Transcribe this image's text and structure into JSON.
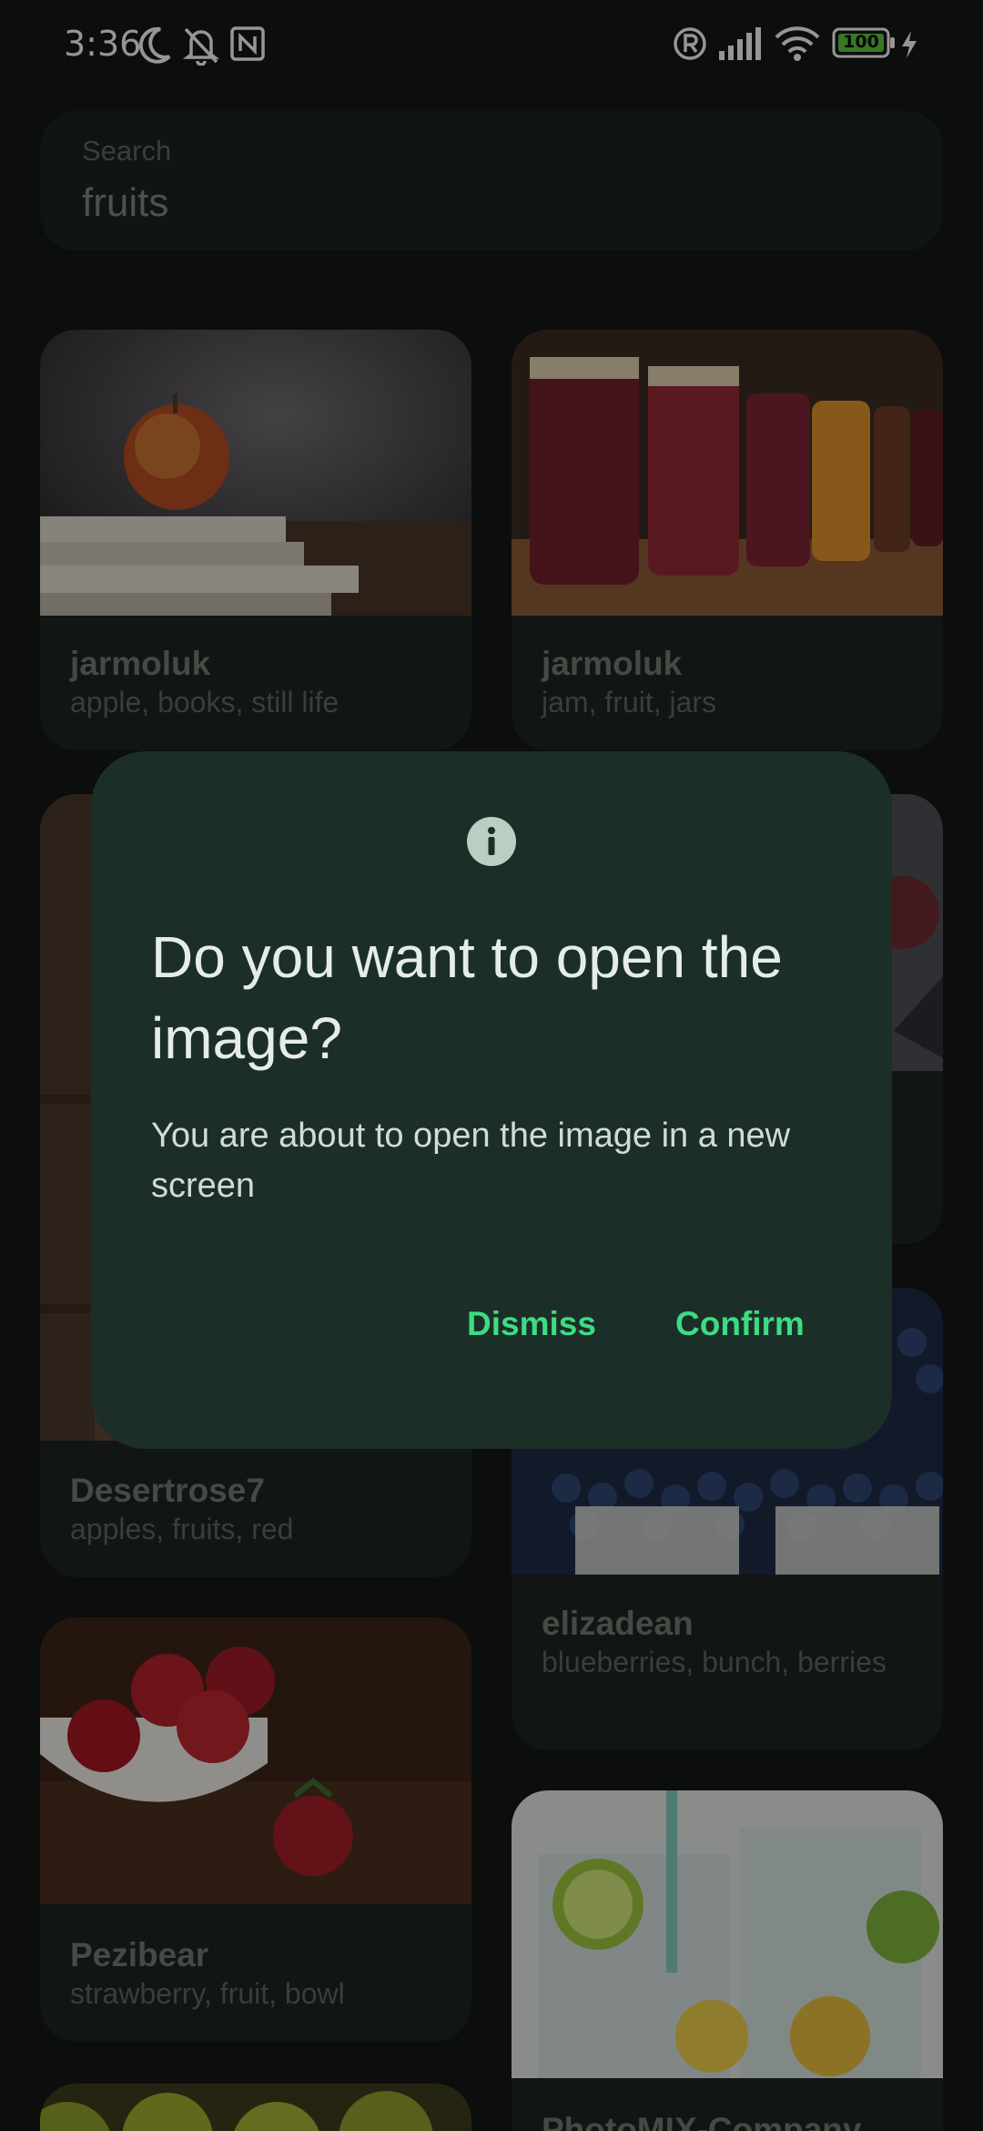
{
  "status_bar": {
    "time": "3:36",
    "battery": "100",
    "icons": [
      "moon-icon",
      "bell-off-icon",
      "nfc-icon",
      "registered-icon",
      "signal-icon",
      "wifi-icon",
      "battery-icon",
      "charging-icon"
    ]
  },
  "search": {
    "label": "Search",
    "value": "fruits"
  },
  "cards": [
    {
      "author": "jarmoluk",
      "tags": "apple, books, still life"
    },
    {
      "author": "jarmoluk",
      "tags": "jam, fruit, jars"
    },
    {
      "author": "Desertrose7",
      "tags": "apples, fruits, red"
    },
    {
      "author": "elizadean",
      "tags": "blueberries, bunch, berries"
    },
    {
      "author": "Pezibear",
      "tags": "strawberry, fruit, bowl"
    },
    {
      "author": "PhotoMIX-Company",
      "tags": ""
    }
  ],
  "dialog": {
    "icon": "info-icon",
    "title": "Do you want to open the image?",
    "body": "You are about to open the image in a new screen",
    "dismiss_label": "Dismiss",
    "confirm_label": "Confirm"
  },
  "colors": {
    "accent": "#3ddc84",
    "dialog_background": "#1c2e28",
    "card_background": "#1c2320",
    "app_background": "#141515"
  }
}
